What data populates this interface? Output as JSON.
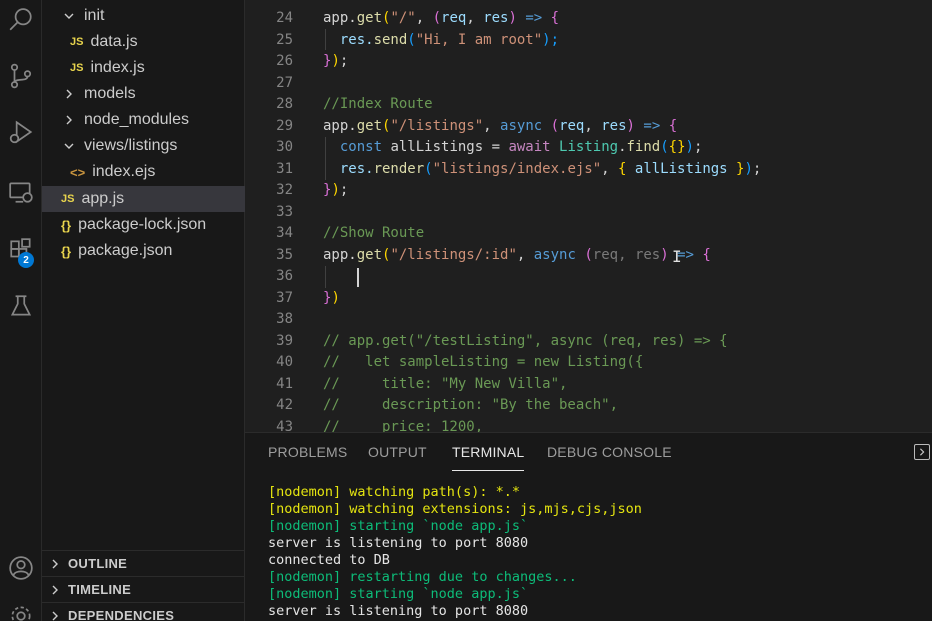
{
  "explorer": {
    "items": [
      {
        "label": "init",
        "type": "folder",
        "expanded": true
      },
      {
        "label": "data.js",
        "type": "js"
      },
      {
        "label": "index.js",
        "type": "js"
      },
      {
        "label": "models",
        "type": "folder",
        "expanded": false
      },
      {
        "label": "node_modules",
        "type": "folder",
        "expanded": false
      },
      {
        "label": "views/listings",
        "type": "folder",
        "expanded": true
      },
      {
        "label": "index.ejs",
        "type": "ejs"
      },
      {
        "label": "app.js",
        "type": "js",
        "active": true
      },
      {
        "label": "package-lock.json",
        "type": "json"
      },
      {
        "label": "package.json",
        "type": "json"
      }
    ],
    "file_icons": {
      "js": "JS",
      "json": "{}",
      "ejs": "<>"
    }
  },
  "sections": [
    "OUTLINE",
    "TIMELINE",
    "DEPENDENCIES"
  ],
  "activity_bar": {
    "icons": [
      "search-icon",
      "source-control-icon",
      "run-debug-icon",
      "remote-explorer-icon",
      "extensions-icon",
      "testing-icon",
      "account-icon",
      "settings-icon"
    ],
    "extensions_badge": "2"
  },
  "editor": {
    "lines": [
      {
        "n": "24",
        "tokens": [
          {
            "t": "app.",
            "c": "plain"
          },
          {
            "t": "get",
            "c": "fn"
          },
          {
            "t": "(",
            "c": "br1"
          },
          {
            "t": "\"/\"",
            "c": "str"
          },
          {
            "t": ", ",
            "c": "plain"
          },
          {
            "t": "(",
            "c": "br2"
          },
          {
            "t": "req",
            "c": "var"
          },
          {
            "t": ", ",
            "c": "plain"
          },
          {
            "t": "res",
            "c": "var"
          },
          {
            "t": ")",
            "c": "br2"
          },
          {
            "t": " ",
            "c": "plain"
          },
          {
            "t": "=>",
            "c": "kw"
          },
          {
            "t": " ",
            "c": "plain"
          },
          {
            "t": "{",
            "c": "br2"
          }
        ]
      },
      {
        "n": "25",
        "tokens": [
          {
            "t": "  res.",
            "c": "var"
          },
          {
            "t": "send",
            "c": "fn"
          },
          {
            "t": "(",
            "c": "br3"
          },
          {
            "t": "\"Hi, I am root\"",
            "c": "str"
          },
          {
            "t": ");",
            "c": "br3"
          }
        ]
      },
      {
        "n": "26",
        "tokens": [
          {
            "t": "}",
            "c": "br2"
          },
          {
            "t": ")",
            "c": "br1"
          },
          {
            "t": ";",
            "c": "plain"
          }
        ]
      },
      {
        "n": "27",
        "tokens": []
      },
      {
        "n": "28",
        "tokens": [
          {
            "t": "//Index Route",
            "c": "cmt"
          }
        ]
      },
      {
        "n": "29",
        "tokens": [
          {
            "t": "app.",
            "c": "plain"
          },
          {
            "t": "get",
            "c": "fn"
          },
          {
            "t": "(",
            "c": "br1"
          },
          {
            "t": "\"/listings\"",
            "c": "str"
          },
          {
            "t": ", ",
            "c": "plain"
          },
          {
            "t": "async",
            "c": "kw"
          },
          {
            "t": " ",
            "c": "plain"
          },
          {
            "t": "(",
            "c": "br2"
          },
          {
            "t": "req",
            "c": "var"
          },
          {
            "t": ", ",
            "c": "plain"
          },
          {
            "t": "res",
            "c": "var"
          },
          {
            "t": ")",
            "c": "br2"
          },
          {
            "t": " ",
            "c": "plain"
          },
          {
            "t": "=>",
            "c": "kw"
          },
          {
            "t": " ",
            "c": "plain"
          },
          {
            "t": "{",
            "c": "br2"
          }
        ]
      },
      {
        "n": "30",
        "tokens": [
          {
            "t": "  ",
            "c": "plain"
          },
          {
            "t": "const",
            "c": "kw"
          },
          {
            "t": " allListings = ",
            "c": "plain"
          },
          {
            "t": "await",
            "c": "ctl"
          },
          {
            "t": " ",
            "c": "plain"
          },
          {
            "t": "Listing",
            "c": "cls"
          },
          {
            "t": ".",
            "c": "plain"
          },
          {
            "t": "find",
            "c": "fn"
          },
          {
            "t": "(",
            "c": "br3"
          },
          {
            "t": "{}",
            "c": "br1"
          },
          {
            "t": ")",
            "c": "br3"
          },
          {
            "t": ";",
            "c": "plain"
          }
        ]
      },
      {
        "n": "31",
        "tokens": [
          {
            "t": "  res.",
            "c": "var"
          },
          {
            "t": "render",
            "c": "fn"
          },
          {
            "t": "(",
            "c": "br3"
          },
          {
            "t": "\"listings/index.ejs\"",
            "c": "str"
          },
          {
            "t": ", ",
            "c": "plain"
          },
          {
            "t": "{",
            "c": "br1"
          },
          {
            "t": " allListings ",
            "c": "var"
          },
          {
            "t": "}",
            "c": "br1"
          },
          {
            "t": ")",
            "c": "br3"
          },
          {
            "t": ";",
            "c": "plain"
          }
        ]
      },
      {
        "n": "32",
        "tokens": [
          {
            "t": "}",
            "c": "br2"
          },
          {
            "t": ")",
            "c": "br1"
          },
          {
            "t": ";",
            "c": "plain"
          }
        ]
      },
      {
        "n": "33",
        "tokens": []
      },
      {
        "n": "34",
        "tokens": [
          {
            "t": "//Show Route",
            "c": "cmt"
          }
        ]
      },
      {
        "n": "35",
        "tokens": [
          {
            "t": "app.",
            "c": "plain"
          },
          {
            "t": "get",
            "c": "fn"
          },
          {
            "t": "(",
            "c": "br1"
          },
          {
            "t": "\"/listings/:id\"",
            "c": "str"
          },
          {
            "t": ", ",
            "c": "plain"
          },
          {
            "t": "async",
            "c": "kw"
          },
          {
            "t": " ",
            "c": "plain"
          },
          {
            "t": "(",
            "c": "br2"
          },
          {
            "t": "req",
            "c": "dim"
          },
          {
            "t": ", ",
            "c": "dim"
          },
          {
            "t": "res",
            "c": "dim"
          },
          {
            "t": ")",
            "c": "br2"
          },
          {
            "t": " ",
            "c": "plain"
          },
          {
            "t": "=>",
            "c": "kw"
          },
          {
            "t": " ",
            "c": "plain"
          },
          {
            "t": "{",
            "c": "br2"
          }
        ]
      },
      {
        "n": "36",
        "tokens": []
      },
      {
        "n": "37",
        "tokens": [
          {
            "t": "}",
            "c": "br2"
          },
          {
            "t": ")",
            "c": "br1"
          }
        ]
      },
      {
        "n": "38",
        "tokens": []
      },
      {
        "n": "39",
        "tokens": [
          {
            "t": "// app.get(\"/testListing\", async (req, res) => {",
            "c": "cmt"
          }
        ]
      },
      {
        "n": "40",
        "tokens": [
          {
            "t": "//   let sampleListing = new Listing({",
            "c": "cmt"
          }
        ]
      },
      {
        "n": "41",
        "tokens": [
          {
            "t": "//     title: \"My New Villa\",",
            "c": "cmt"
          }
        ]
      },
      {
        "n": "42",
        "tokens": [
          {
            "t": "//     description: \"By the beach\",",
            "c": "cmt"
          }
        ]
      },
      {
        "n": "43",
        "tokens": [
          {
            "t": "//     price: 1200,",
            "c": "cmt"
          }
        ]
      }
    ]
  },
  "panel": {
    "tabs": [
      "PROBLEMS",
      "OUTPUT",
      "TERMINAL",
      "DEBUG CONSOLE"
    ],
    "active_tab": "TERMINAL",
    "terminal_lines": [
      {
        "text": "[nodemon] watching path(s): *.*",
        "color": "yellow"
      },
      {
        "text": "[nodemon] watching extensions: js,mjs,cjs,json",
        "color": "yellow"
      },
      {
        "text": "[nodemon] starting `node app.js`",
        "color": "green"
      },
      {
        "text": "server is listening to port 8080",
        "color": "white"
      },
      {
        "text": "connected to DB",
        "color": "white"
      },
      {
        "text": "[nodemon] restarting due to changes...",
        "color": "green"
      },
      {
        "text": "[nodemon] starting `node app.js`",
        "color": "green"
      },
      {
        "text": "server is listening to port 8080",
        "color": "white"
      }
    ]
  },
  "colors": {
    "editor_bg": "#1f1f1f",
    "sidebar_bg": "#181818",
    "active_row": "#37373d",
    "badge": "#0078d4"
  }
}
